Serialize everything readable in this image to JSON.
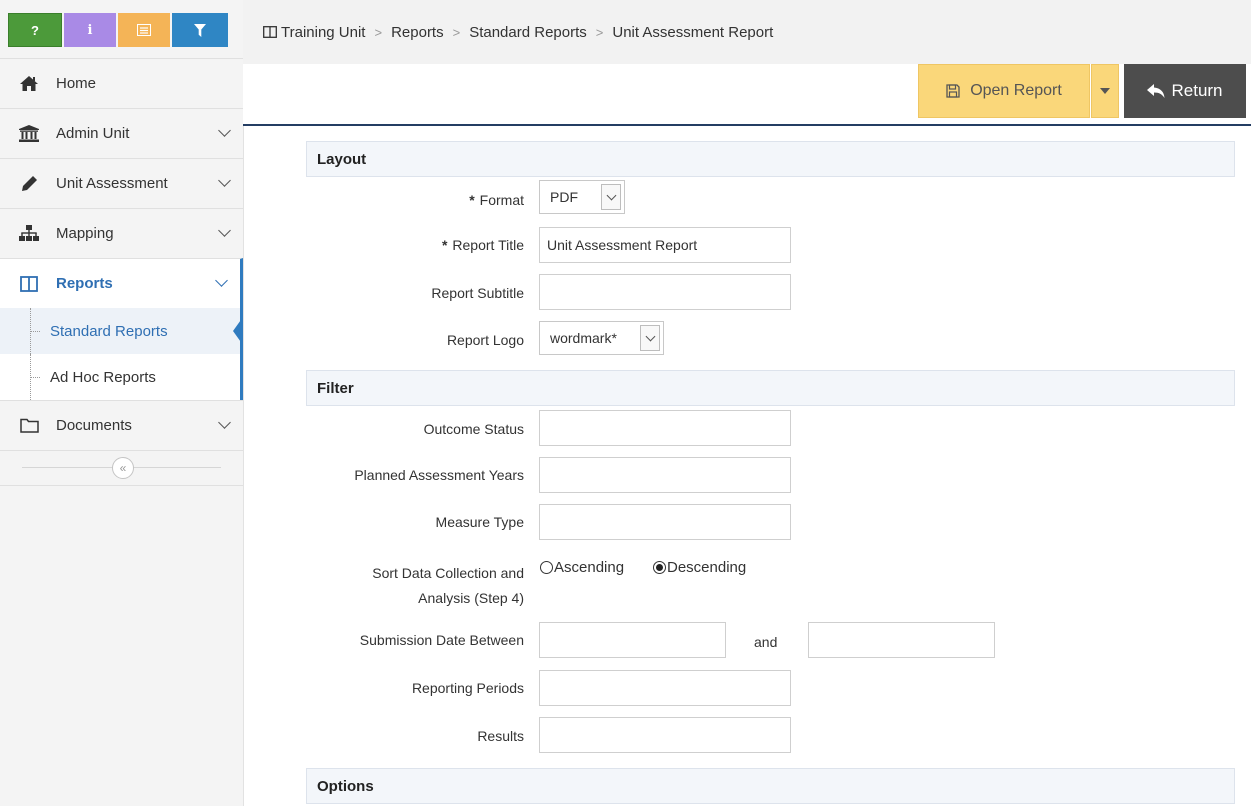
{
  "quick_bar": {
    "help": "?",
    "info": "i"
  },
  "sidebar": {
    "items": [
      {
        "label": "Home"
      },
      {
        "label": "Admin Unit"
      },
      {
        "label": "Unit Assessment"
      },
      {
        "label": "Mapping"
      },
      {
        "label": "Reports"
      },
      {
        "label": "Documents"
      }
    ],
    "reports_sub": [
      {
        "label": "Standard Reports"
      },
      {
        "label": "Ad Hoc Reports"
      }
    ],
    "collapse_glyph": "«"
  },
  "breadcrumb": {
    "items": [
      "Training Unit",
      "Reports",
      "Standard Reports",
      "Unit Assessment Report"
    ],
    "separator": ">"
  },
  "toolbar": {
    "open_report_label": "Open Report",
    "return_label": "Return"
  },
  "layout_section": {
    "title": "Layout",
    "required_marker": "*",
    "format_label": "Format",
    "format_value": "PDF",
    "report_title_label": "Report Title",
    "report_title_value": "Unit Assessment Report",
    "report_subtitle_label": "Report Subtitle",
    "report_subtitle_value": "",
    "report_logo_label": "Report Logo",
    "report_logo_value": "wordmark*"
  },
  "filter_section": {
    "title": "Filter",
    "outcome_status_label": "Outcome Status",
    "planned_years_label": "Planned Assessment Years",
    "measure_type_label": "Measure Type",
    "sort_label_line1": "Sort Data Collection and",
    "sort_label_line2": "Analysis (Step 4)",
    "ascending_label": "Ascending",
    "descending_label": "Descending",
    "sort_selected": "Descending",
    "submission_date_label": "Submission Date Between",
    "and_label": "and",
    "reporting_periods_label": "Reporting Periods",
    "results_label": "Results"
  },
  "options_section": {
    "title": "Options"
  },
  "colors": {
    "help_btn": "#4c9a3a",
    "info_btn": "#a98ae6",
    "notes_btn": "#f4b457",
    "filter_btn": "#2f86c4",
    "accent": "#2f7bbf",
    "open_report_btn": "#fad77a",
    "return_btn": "#4d4d4d",
    "toolbar_rule": "#243d63"
  }
}
